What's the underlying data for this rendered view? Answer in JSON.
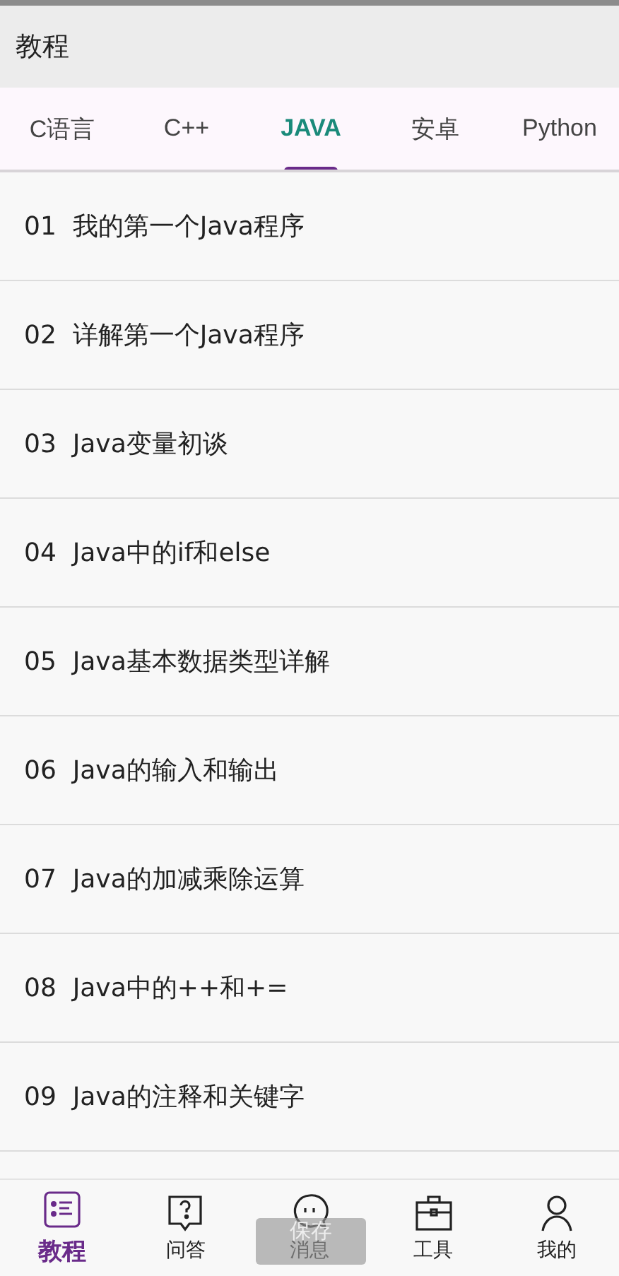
{
  "header": {
    "title": "教程"
  },
  "tabs": [
    {
      "label": "C语言",
      "selected": false
    },
    {
      "label": "C++",
      "selected": false
    },
    {
      "label": "JAVA",
      "selected": true
    },
    {
      "label": "安卓",
      "selected": false
    },
    {
      "label": "Python",
      "selected": false
    }
  ],
  "lessons": [
    {
      "number": "01",
      "title": "我的第一个Java程序"
    },
    {
      "number": "02",
      "title": "详解第一个Java程序"
    },
    {
      "number": "03",
      "title": "Java变量初谈"
    },
    {
      "number": "04",
      "title": "Java中的if和else"
    },
    {
      "number": "05",
      "title": "Java基本数据类型详解"
    },
    {
      "number": "06",
      "title": "Java的输入和输出"
    },
    {
      "number": "07",
      "title": "Java的加减乘除运算"
    },
    {
      "number": "08",
      "title": "Java中的++和+="
    },
    {
      "number": "09",
      "title": "Java的注释和关键字"
    }
  ],
  "bottom_nav": [
    {
      "label": "教程",
      "kind": "list",
      "selected": true
    },
    {
      "label": "问答",
      "kind": "question",
      "selected": false
    },
    {
      "label": "消息",
      "kind": "chat",
      "selected": false
    },
    {
      "label": "工具",
      "kind": "toolbox",
      "selected": false
    },
    {
      "label": "我的",
      "kind": "person",
      "selected": false
    }
  ],
  "toast": "保存"
}
